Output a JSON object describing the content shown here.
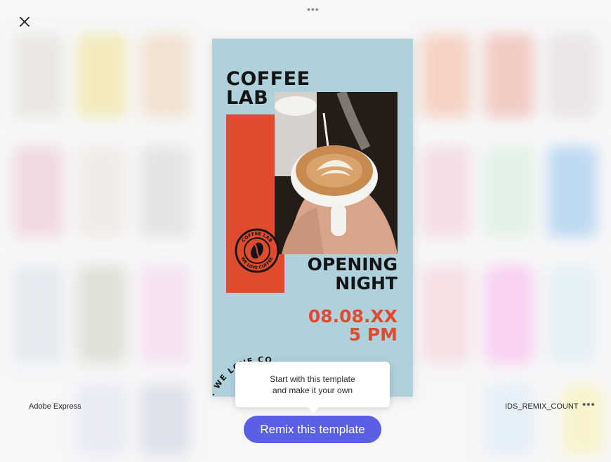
{
  "top_handle": "•••",
  "poster": {
    "brand_line1": "COFFEE",
    "brand_line2": "LAB",
    "headline_line1": "OPENING",
    "headline_line2": "NIGHT",
    "date_line1": "08.08.XX",
    "date_line2": "5 PM",
    "arc_text": "· WE LOVE CO",
    "badge_top_text": "COFFEE LAB",
    "badge_bottom_text": "WE LOVE COFFEE"
  },
  "tooltip": {
    "line1": "Start with this template",
    "line2": "and make it your own"
  },
  "remix_button_label": "Remix this template",
  "footer": {
    "app_name": "Adobe Express",
    "remix_count": "IDS_REMIX_COUNT",
    "more_label": "•••"
  },
  "colors": {
    "accent": "#5b5fe3",
    "poster_bg": "#afd1dc",
    "poster_red": "#e04a2d"
  }
}
